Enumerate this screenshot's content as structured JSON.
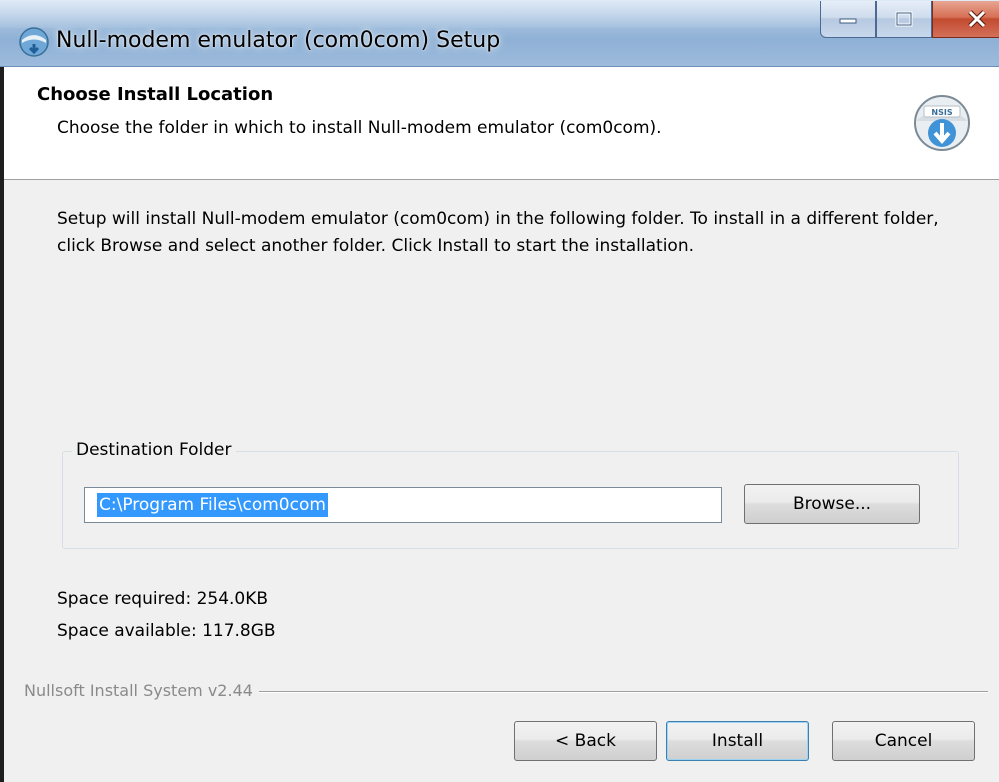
{
  "window": {
    "title": "Null-modem emulator (com0com) Setup",
    "accent_color": "#9dbbdc",
    "close_color": "#c14b2f"
  },
  "header": {
    "title": "Choose Install Location",
    "subtitle": "Choose the folder in which to install Null-modem emulator (com0com).",
    "icon_badge": "NSIS"
  },
  "body": {
    "instructions": "Setup will install Null-modem emulator (com0com) in the following folder. To install in a different folder, click Browse and select another folder. Click Install to start the installation."
  },
  "destination": {
    "legend": "Destination Folder",
    "path": "C:\\Program Files\\com0com",
    "browse_label": "Browse..."
  },
  "space": {
    "required": "Space required: 254.0KB",
    "available": "Space available: 117.8GB"
  },
  "branding": {
    "text": "Nullsoft Install System v2.44"
  },
  "buttons": {
    "back": "< Back",
    "install": "Install",
    "cancel": "Cancel"
  }
}
